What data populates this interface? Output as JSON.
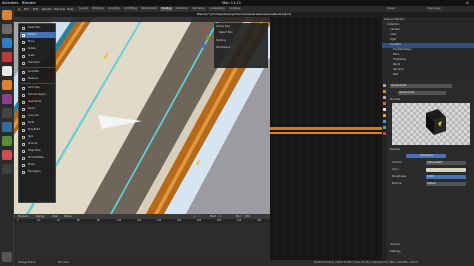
{
  "topbar": {
    "activities": "Activities",
    "app_name": "Blender",
    "clock": "Mon 11:11",
    "tray": "⏻"
  },
  "menubar": {
    "items": [
      "File",
      "Edit",
      "Render",
      "Window",
      "Help"
    ],
    "workspaces": [
      "Layout",
      "Modeling",
      "Sculpting",
      "UV Editing",
      "Texture Paint",
      "Shading",
      "Animation",
      "Rendering",
      "Compositing",
      "Scripting"
    ],
    "active_workspace": "Shading",
    "scene": "Scene",
    "view_layer": "View Layer"
  },
  "titlebar": {
    "title": "Blender* [/home/jbhs/projects/models/escalators/escalator6.blend]"
  },
  "tool_menu": {
    "items": [
      {
        "label": "Select Box",
        "selected": false
      },
      {
        "label": "Cursor",
        "selected": true
      },
      {
        "label": "Move",
        "selected": false
      },
      {
        "label": "Rotate",
        "selected": false
      },
      {
        "label": "Scale",
        "selected": false
      },
      {
        "label": "Transform",
        "selected": false
      },
      {
        "label": "Annotate",
        "selected": false
      },
      {
        "label": "Measure",
        "selected": false
      },
      {
        "label": "Add Cube",
        "selected": false
      },
      {
        "label": "Extrude Region",
        "selected": false
      },
      {
        "label": "Inset Faces",
        "selected": false
      },
      {
        "label": "Bevel",
        "selected": false
      },
      {
        "label": "Loop Cut",
        "selected": false
      },
      {
        "label": "Knife",
        "selected": false
      },
      {
        "label": "Poly Build",
        "selected": false
      },
      {
        "label": "Spin",
        "selected": false
      },
      {
        "label": "Smooth",
        "selected": false
      },
      {
        "label": "Edge Slide",
        "selected": false
      },
      {
        "label": "Shrink/Fatten",
        "selected": false
      },
      {
        "label": "Shear",
        "selected": false
      },
      {
        "label": "Rip Region",
        "selected": false
      }
    ]
  },
  "n_panel": {
    "rows": [
      "Active Tool",
      "Select Box",
      "Options",
      "Workspace"
    ]
  },
  "outliner": {
    "title": "Scene Collection",
    "rows": [
      {
        "label": "Scene Collection",
        "selected": false
      },
      {
        "label": "Collection",
        "selected": false
      },
      {
        "label": "Camera",
        "selected": false
      },
      {
        "label": "Cube",
        "selected": false
      },
      {
        "label": "Light",
        "selected": false
      },
      {
        "label": "Escalator",
        "selected": true
      },
      {
        "label": "EscalatorSteps",
        "selected": false
      },
      {
        "label": "Rail.L",
        "selected": false
      },
      {
        "label": "Footplates",
        "selected": false
      },
      {
        "label": "Rail.R",
        "selected": false
      },
      {
        "label": "Handrail",
        "selected": false
      },
      {
        "label": "Belt",
        "selected": false
      }
    ]
  },
  "properties": {
    "material_name": "Handrail.001",
    "surface_label": "Surface",
    "surface_value": "Use Nodes",
    "bsdf_label": "Surface",
    "bsdf_value": "Diffuse BSDF",
    "color_label": "Color",
    "roughness_label": "Roughness",
    "roughness_value": "0.000",
    "normal_label": "Normal",
    "normal_value": "Default",
    "volume_label": "Volume",
    "preview_label": "Preview",
    "settings_label": "Settings"
  },
  "timeline": {
    "menus": [
      "Playback",
      "Keying",
      "View",
      "Marker"
    ],
    "start_label": "Start",
    "start": "1",
    "end_label": "End",
    "end": "250",
    "current": "1",
    "ruler": [
      "0",
      "20",
      "40",
      "60",
      "80",
      "100",
      "120",
      "140",
      "160",
      "180",
      "200",
      "220",
      "240"
    ]
  },
  "statusbar": {
    "left": "Change Frame",
    "mid": "Pan View",
    "right": "Escalator6.blend | Verts:12,480 | Faces:11,232 | Objects:1/12 | Mem: 248 MiB | 2.80.75"
  },
  "colors": {
    "accent": "#4772b3",
    "rail_orange": "#c8781e",
    "belt_light": "#e4ddcc",
    "belt_dark": "#6d6358",
    "cyan_line": "#5fd0d6"
  }
}
